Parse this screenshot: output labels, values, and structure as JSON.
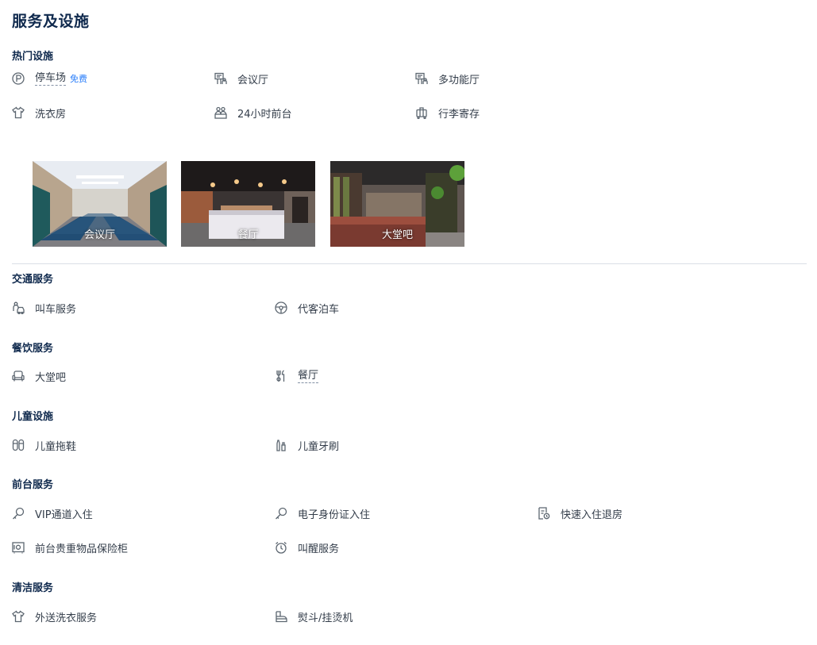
{
  "page_title": "服务及设施",
  "sections": {
    "hot": {
      "title": "热门设施",
      "items": [
        "停车场",
        "会议厅",
        "多功能厅",
        "洗衣房",
        "24小时前台",
        "行李寄存"
      ],
      "parking_badge": "免费"
    },
    "photos": [
      "会议厅",
      "餐厅",
      "大堂吧"
    ],
    "transport": {
      "title": "交通服务",
      "items": [
        "叫车服务",
        "代客泊车"
      ]
    },
    "dining": {
      "title": "餐饮服务",
      "items": [
        "大堂吧",
        "餐厅"
      ]
    },
    "kids": {
      "title": "儿童设施",
      "items": [
        "儿童拖鞋",
        "儿童牙刷"
      ]
    },
    "frontdesk": {
      "title": "前台服务",
      "items": [
        "VIP通道入住",
        "电子身份证入住",
        "快速入住退房",
        "前台贵重物品保险柜",
        "叫醒服务"
      ]
    },
    "cleaning": {
      "title": "清洁服务",
      "items": [
        "外送洗衣服务",
        "熨斗/挂烫机"
      ]
    }
  },
  "icons": [
    "parking-icon",
    "meeting-room-icon",
    "function-hall-icon",
    "laundry-shirt-icon",
    "front-desk-icon",
    "luggage-icon",
    "taxi-icon",
    "valet-steering-icon",
    "sofa-icon",
    "fork-knife-icon",
    "kids-slippers-icon",
    "toothbrush-icon",
    "key-icon",
    "id-key-icon",
    "checkin-document-icon",
    "safe-box-icon",
    "alarm-clock-icon",
    "iron-icon"
  ],
  "colors": {
    "title": "#0f294d",
    "text": "#333d4a",
    "badge": "#287dfa",
    "icon": "#5c6670",
    "divider": "#dadfe6"
  }
}
